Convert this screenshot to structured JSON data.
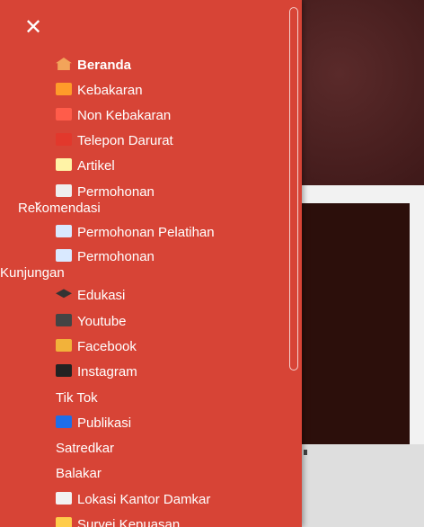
{
  "colors": {
    "drawer_bg": "#d74436",
    "text": "#ffffff",
    "hero_bg": "#2a0f0f"
  },
  "drawer": {
    "close_icon": "close-icon",
    "items": [
      {
        "label": "Beranda",
        "icon": "home-icon"
      },
      {
        "label": "Kebakaran",
        "icon": "fire-icon"
      },
      {
        "label": "Non Kebakaran",
        "icon": "siren-icon"
      },
      {
        "label": "Telepon Darurat",
        "icon": "phone-icon"
      },
      {
        "label": "Artikel",
        "icon": "memo-icon"
      },
      {
        "label_line1": "Permohonan",
        "label_line2": "Rekomendasi",
        "icon": "clipboard-icon",
        "expanded": true
      },
      {
        "label": "Permohonan Pelatihan",
        "icon": "document-icon"
      },
      {
        "label_line1": "Permohonan",
        "label_line2": "Kunjungan",
        "icon": "document-icon"
      },
      {
        "label": "Edukasi",
        "icon": "graduation-cap-icon"
      },
      {
        "label": "Youtube",
        "icon": "clapper-icon"
      },
      {
        "label": "Facebook",
        "icon": "hook-icon"
      },
      {
        "label": "Instagram",
        "icon": "phone-arrow-icon"
      },
      {
        "label": "Tik Tok"
      },
      {
        "label": "Publikasi",
        "icon": "globe-icon"
      },
      {
        "label": "Satredkar"
      },
      {
        "label": "Balakar"
      },
      {
        "label": "Lokasi Kantor Damkar",
        "icon": "card-icon"
      },
      {
        "label": "Survei Kepuasan",
        "icon": "survey-icon"
      }
    ]
  }
}
